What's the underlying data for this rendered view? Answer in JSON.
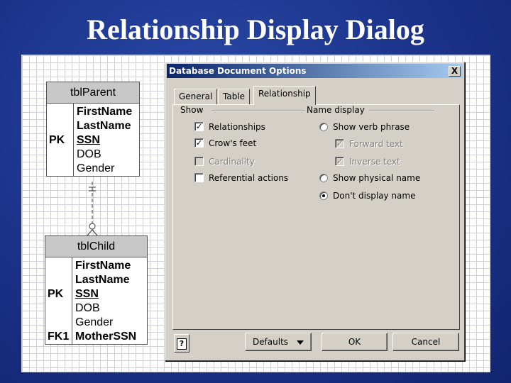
{
  "slide": {
    "title": "Relationship Display Dialog"
  },
  "diagram": {
    "parent": {
      "name": "tblParent",
      "rows": [
        {
          "key": "",
          "field": "FirstName",
          "style": "bold"
        },
        {
          "key": "",
          "field": "LastName",
          "style": "bold"
        },
        {
          "key": "PK",
          "field": "SSN",
          "style": "underline"
        },
        {
          "key": "",
          "field": "DOB",
          "style": "normal"
        },
        {
          "key": "",
          "field": "Gender",
          "style": "normal"
        }
      ]
    },
    "child": {
      "name": "tblChild",
      "rows": [
        {
          "key": "",
          "field": "FirstName",
          "style": "bold"
        },
        {
          "key": "",
          "field": "LastName",
          "style": "bold"
        },
        {
          "key": "PK",
          "field": "SSN",
          "style": "underline"
        },
        {
          "key": "",
          "field": "DOB",
          "style": "normal"
        },
        {
          "key": "",
          "field": "Gender",
          "style": "normal"
        },
        {
          "key": "FK1",
          "field": "MotherSSN",
          "style": "bold"
        }
      ]
    }
  },
  "dialog": {
    "title": "Database Document Options",
    "close_label": "X",
    "tabs": [
      {
        "label": "General",
        "active": false
      },
      {
        "label": "Table",
        "active": false
      },
      {
        "label": "Relationship",
        "active": true
      }
    ],
    "show": {
      "label": "Show",
      "options": [
        {
          "label": "Relationships",
          "checked": true,
          "enabled": true
        },
        {
          "label": "Crow's feet",
          "checked": true,
          "enabled": true
        },
        {
          "label": "Cardinality",
          "checked": false,
          "enabled": false
        },
        {
          "label": "Referential actions",
          "checked": false,
          "enabled": true
        }
      ]
    },
    "name_display": {
      "label": "Name display",
      "show_verb_phrase": {
        "label": "Show verb phrase",
        "selected": false
      },
      "forward_text": {
        "label": "Forward text",
        "checked": true,
        "enabled": false
      },
      "inverse_text": {
        "label": "Inverse text",
        "checked": true,
        "enabled": false
      },
      "show_physical_name": {
        "label": "Show physical name",
        "selected": false
      },
      "dont_display_name": {
        "label": "Don't display name",
        "selected": true
      }
    },
    "buttons": {
      "help": "?",
      "defaults": "Defaults",
      "ok": "OK",
      "cancel": "Cancel"
    }
  }
}
